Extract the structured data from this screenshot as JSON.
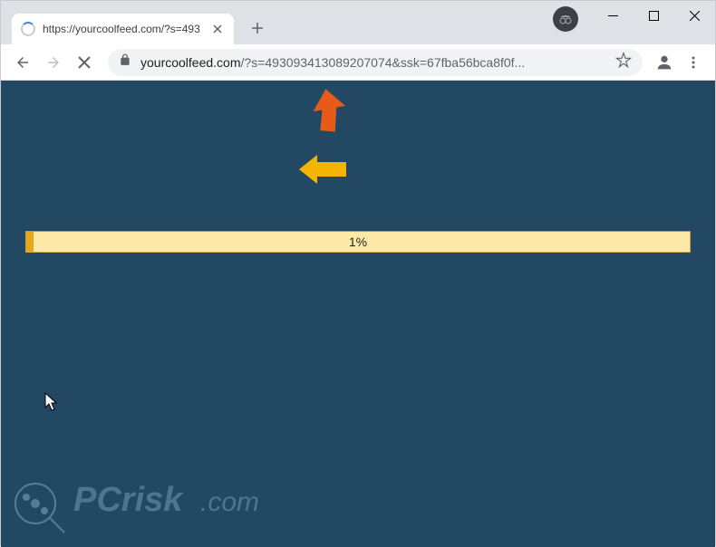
{
  "window": {
    "tab_title": "https://yourcoolfeed.com/?s=493",
    "incognito": true
  },
  "toolbar": {
    "url_domain": "yourcoolfeed.com",
    "url_path": "/?s=493093413089207074&ssk=67fba56bca8f0f..."
  },
  "content": {
    "progress_percent": "1%",
    "progress_value": 1
  },
  "watermark": {
    "text": "PCrisk.com"
  },
  "colors": {
    "page_bg": "#224863",
    "progress_track": "#ffe9a8",
    "progress_fill": "#e6a817"
  }
}
